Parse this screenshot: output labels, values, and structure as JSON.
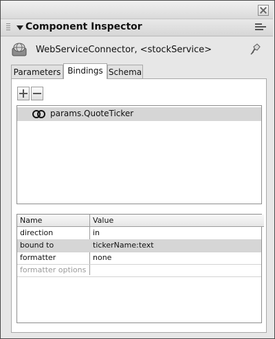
{
  "window": {
    "close_icon": "close-icon"
  },
  "panel": {
    "title": "Component Inspector",
    "options_icon": "options-menu-icon"
  },
  "component": {
    "name": "WebServiceConnector, <stockService>",
    "icon": "web-service-component-icon",
    "pin_icon": "pin-icon"
  },
  "tabs": [
    {
      "label": "Parameters",
      "active": false
    },
    {
      "label": "Bindings",
      "active": true
    },
    {
      "label": "Schema",
      "active": false
    }
  ],
  "toolbar": {
    "add_icon": "add-binding-icon",
    "remove_icon": "remove-binding-icon"
  },
  "bindings": [
    {
      "label": "params.QuoteTicker",
      "icon": "binding-link-icon",
      "selected": true
    }
  ],
  "properties": {
    "columns": [
      "Name",
      "Value"
    ],
    "rows": [
      {
        "name": "direction",
        "value": "in",
        "highlight": false,
        "disabled": false
      },
      {
        "name": "bound to",
        "value": "tickerName:text",
        "highlight": true,
        "disabled": false
      },
      {
        "name": "formatter",
        "value": "none",
        "highlight": false,
        "disabled": false
      },
      {
        "name": "formatter options",
        "value": "",
        "highlight": false,
        "disabled": true
      }
    ]
  },
  "colors": {
    "selected_row": "#d6d6d6",
    "disabled_text": "#9a9a9a"
  }
}
